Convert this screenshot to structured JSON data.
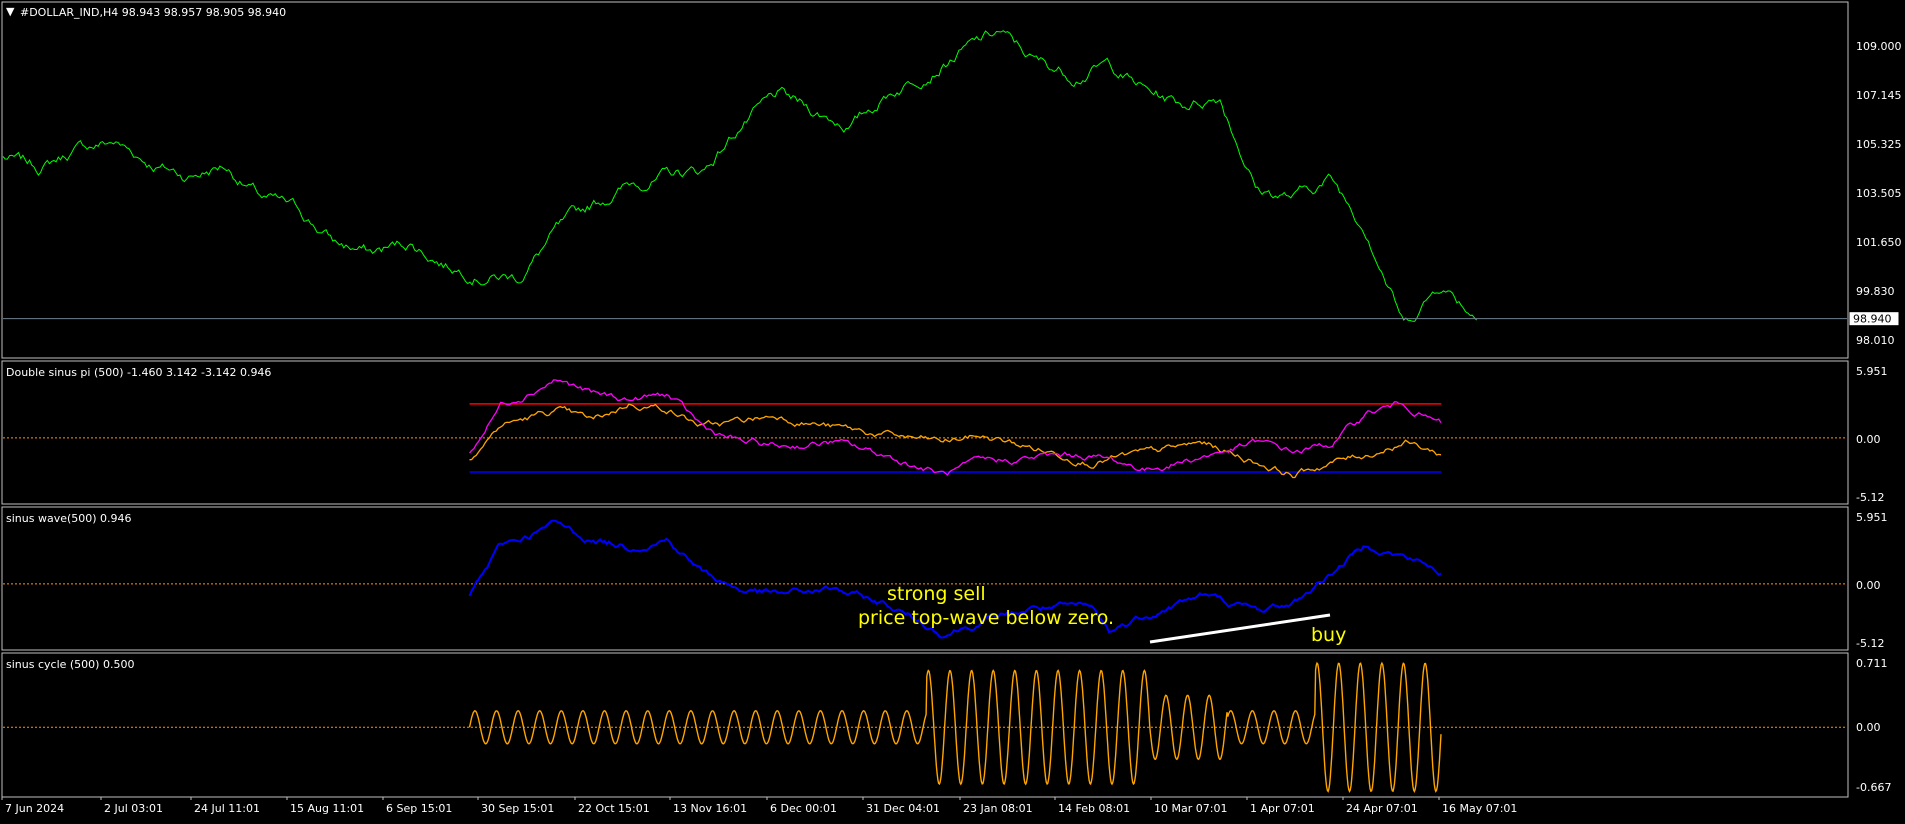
{
  "colors": {
    "background": "#000000",
    "frame": "#c0c0c0",
    "text": "#ffffff",
    "price_line": "#00ff00",
    "zero_line": "#ff9900",
    "magenta": "#ff00ff",
    "orange": "#ffa500",
    "red_level": "#ff0000",
    "blue_level": "#0000ff",
    "blue_wave": "#0000ff",
    "cycle": "#ffa500",
    "annotation": "#ffff00",
    "trendline": "#ffffff",
    "bid_line": "#708090"
  },
  "main_panel": {
    "header": "#DOLLAR_IND,H4  98.943 98.957 98.905 98.940",
    "header_glyph": "▼",
    "price_tag": "98.940"
  },
  "panel_labels": [
    "Double sinus pi (500) -1.460 3.142 -3.142 0.946",
    "sinus wave(500) 0.946",
    "sinus cycle (500) 0.500"
  ],
  "annotations": {
    "strong_sell": "strong sell",
    "price_top_wave": "price top-wave below zero.",
    "buy": "buy"
  },
  "chart_data": [
    {
      "type": "line",
      "title": "#DOLLAR_IND,H4",
      "y_ticks": [
        "109.000",
        "107.145",
        "105.325",
        "103.505",
        "101.650",
        "99.830",
        "98.010"
      ],
      "ylim": [
        97.5,
        110.8
      ],
      "current_price": 98.94,
      "series": [
        {
          "name": "",
          "x": [
            0,
            0.02,
            0.04,
            0.06,
            0.08,
            0.1,
            0.12,
            0.14,
            0.16,
            0.18,
            0.2,
            0.22,
            0.24,
            0.26,
            0.28,
            0.3,
            0.32,
            0.34,
            0.36,
            0.38,
            0.4,
            0.42,
            0.44,
            0.46,
            0.48,
            0.5,
            0.52,
            0.54,
            0.56,
            0.58,
            0.6,
            0.62,
            0.64,
            0.66,
            0.68,
            0.7,
            0.72,
            0.74,
            0.76,
            0.78,
            0.8
          ],
          "values": [
            105.0,
            104.6,
            105.3,
            105.6,
            104.8,
            104.3,
            104.7,
            103.5,
            103.0,
            101.8,
            101.4,
            101.8,
            101.0,
            100.6,
            100.5,
            102.2,
            103.2,
            104.0,
            104.3,
            104.5,
            106.2,
            107.3,
            106.7,
            106.2,
            107.4,
            108.2,
            109.0,
            109.7,
            108.6,
            108.1,
            108.5,
            107.5,
            107.0,
            107.3,
            103.8,
            103.5,
            104.2,
            102.3,
            98.7,
            100.3,
            99.0
          ]
        }
      ]
    },
    {
      "type": "line",
      "title": "Double sinus pi (500)",
      "y_ticks": [
        "5.951",
        "0.00",
        "-5.12"
      ],
      "ylim": [
        -6.0,
        7.0
      ],
      "levels": {
        "upper": 3.142,
        "lower": -3.142
      },
      "series": [
        {
          "name": "",
          "x": [
            0.253,
            0.27,
            0.3,
            0.32,
            0.34,
            0.36,
            0.38,
            0.4,
            0.42,
            0.45,
            0.48,
            0.51,
            0.53,
            0.56,
            0.59,
            0.62,
            0.65,
            0.68,
            0.7,
            0.72,
            0.74,
            0.76,
            0.78
          ],
          "values": [
            -1.5,
            3.1,
            5.5,
            4.0,
            3.5,
            4.0,
            0.9,
            -0.4,
            -0.8,
            -0.4,
            -1.7,
            -3.4,
            -2.4,
            -1.8,
            -1.6,
            -2.9,
            -1.7,
            -0.5,
            -1.3,
            -0.6,
            2.3,
            3.2,
            1.2
          ]
        },
        {
          "name": "",
          "x": [
            0.253,
            0.27,
            0.3,
            0.32,
            0.34,
            0.36,
            0.38,
            0.4,
            0.42,
            0.45,
            0.48,
            0.51,
            0.53,
            0.56,
            0.59,
            0.62,
            0.65,
            0.68,
            0.7,
            0.72,
            0.74,
            0.76,
            0.78
          ],
          "values": [
            -1.8,
            1.2,
            2.5,
            1.5,
            3.2,
            2.8,
            1.0,
            1.5,
            2.1,
            1.0,
            0.2,
            -0.4,
            0.2,
            -1.0,
            -2.1,
            -1.5,
            -0.5,
            -2.2,
            -3.4,
            -2.3,
            -1.5,
            -0.3,
            -1.5
          ]
        }
      ]
    },
    {
      "type": "line",
      "title": "sinus wave(500)",
      "y_ticks": [
        "5.951",
        "0.00",
        "-5.12"
      ],
      "ylim": [
        -6.0,
        7.0
      ],
      "series": [
        {
          "name": "",
          "x": [
            0.253,
            0.27,
            0.3,
            0.32,
            0.34,
            0.36,
            0.38,
            0.4,
            0.42,
            0.45,
            0.48,
            0.51,
            0.53,
            0.56,
            0.59,
            0.6,
            0.62,
            0.65,
            0.68,
            0.7,
            0.72,
            0.74,
            0.76,
            0.78
          ],
          "values": [
            -1.0,
            3.5,
            5.5,
            4.0,
            3.5,
            4.2,
            1.0,
            -0.5,
            -1.0,
            -0.5,
            -2.0,
            -4.5,
            -3.5,
            -2.2,
            -2.3,
            -4.5,
            -2.8,
            -1.0,
            -2.5,
            -1.8,
            1.0,
            3.8,
            2.5,
            1.1
          ]
        }
      ]
    },
    {
      "type": "line",
      "title": "sinus cycle (500)",
      "y_ticks": [
        "0.711",
        "0.00",
        "-0.667"
      ],
      "ylim": [
        -0.75,
        0.8
      ]
    }
  ],
  "time_axis": {
    "ticks": [
      "7 Jun 2024",
      "2 Jul 03:01",
      "24 Jul 11:01",
      "15 Aug 11:01",
      "6 Sep 15:01",
      "30 Sep 15:01",
      "22 Oct 15:01",
      "13 Nov 16:01",
      "6 Dec 00:01",
      "31 Dec 04:01",
      "23 Jan 08:01",
      "14 Feb 08:01",
      "10 Mar 07:01",
      "1 Apr 07:01",
      "24 Apr 07:01",
      "16 May 07:01"
    ]
  }
}
